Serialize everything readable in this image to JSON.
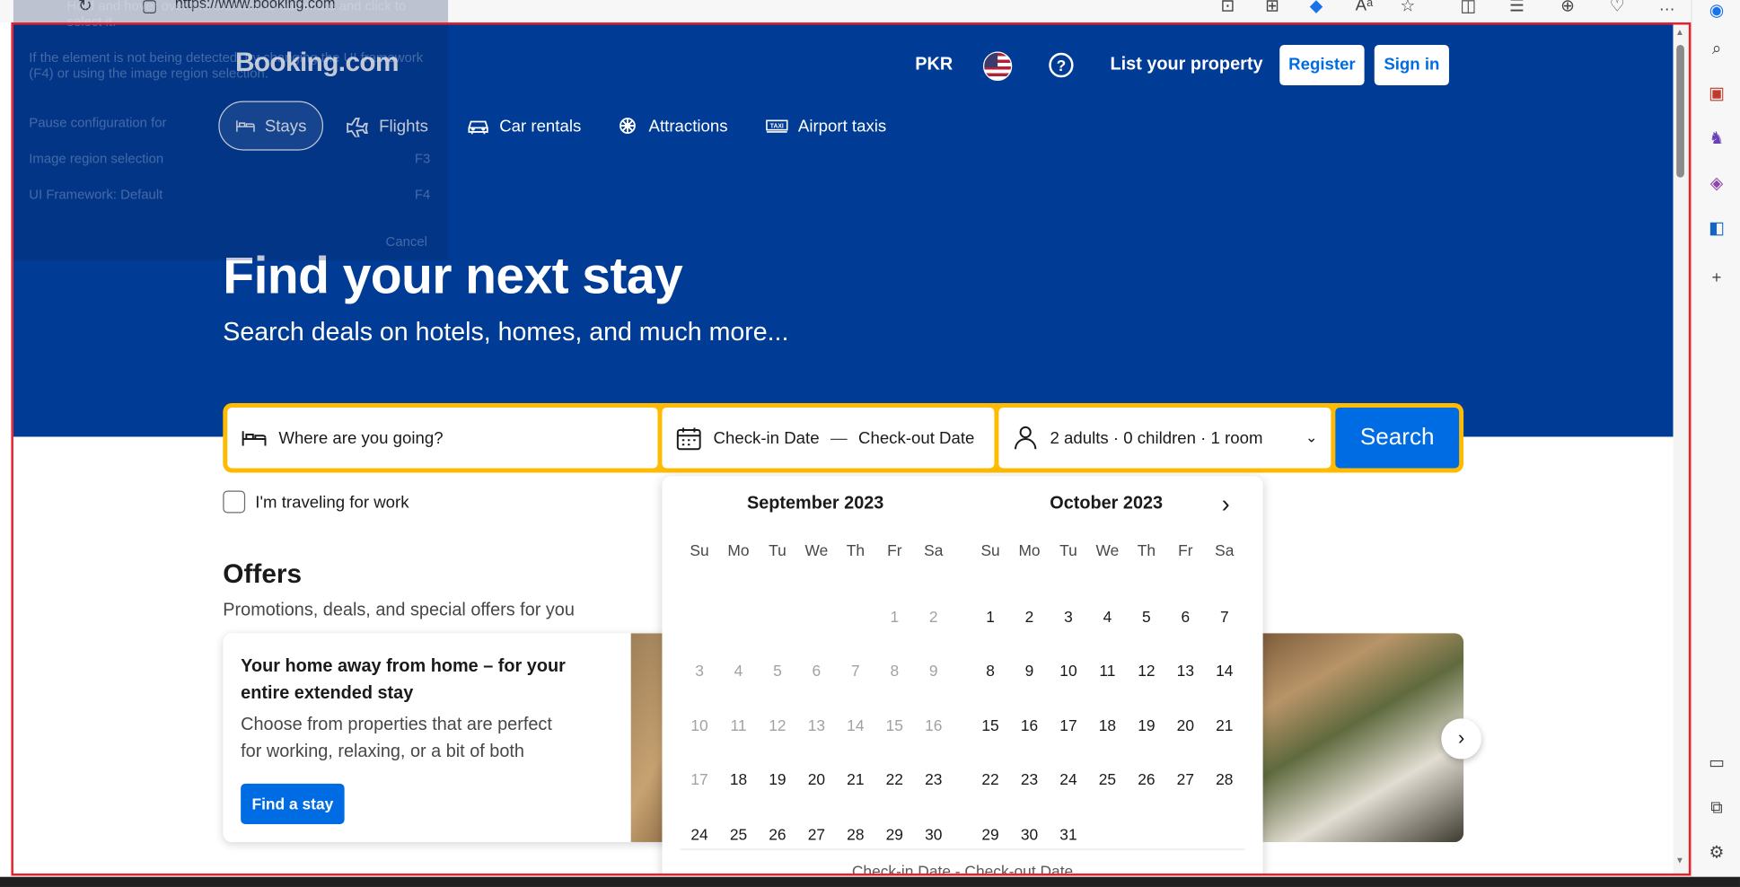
{
  "browser": {
    "url": "https://www.booking.com"
  },
  "overlay": {
    "line1": "Hold and hover over the element to automate and click to select it.",
    "line2": "If the element is not being detected, try changing the UI framework (F4) or using the image region selection.",
    "line3": "Pause configuration for",
    "line4": "Image region selection",
    "line4_key": "F3",
    "line5": "UI Framework: Default",
    "line5_key": "F4",
    "cancel": "Cancel"
  },
  "header": {
    "logo": "Booking.com",
    "currency": "PKR",
    "help_symbol": "?",
    "list_property": "List your property",
    "register": "Register",
    "sign_in": "Sign in"
  },
  "nav": {
    "items": [
      {
        "label": "Stays",
        "icon": "bed-icon",
        "active": true
      },
      {
        "label": "Flights",
        "icon": "plane-icon",
        "active": false
      },
      {
        "label": "Car rentals",
        "icon": "car-icon",
        "active": false
      },
      {
        "label": "Attractions",
        "icon": "attractions-icon",
        "active": false
      },
      {
        "label": "Airport taxis",
        "icon": "taxi-icon",
        "active": false
      }
    ]
  },
  "hero": {
    "title": "Find your next stay",
    "subtitle": "Search deals on hotels, homes, and much more..."
  },
  "search": {
    "destination_placeholder": "Where are you going?",
    "checkin": "Check-in Date",
    "date_separator": "—",
    "checkout": "Check-out Date",
    "occupancy": "2 adults · 0 children · 1 room",
    "button": "Search",
    "work_travel": "I'm traveling for work"
  },
  "calendar": {
    "weekdays": [
      "Su",
      "Mo",
      "Tu",
      "We",
      "Th",
      "Fr",
      "Sa"
    ],
    "months": [
      {
        "title": "September 2023",
        "first_weekday": 5,
        "days": 30,
        "past_until": 16,
        "past_extra": [
          17
        ]
      },
      {
        "title": "October 2023",
        "first_weekday": 0,
        "days": 31,
        "past_until": 0,
        "past_extra": []
      }
    ],
    "footer": "Check-in Date - Check-out Date"
  },
  "offers": {
    "title": "Offers",
    "subtitle": "Promotions, deals, and special offers for you",
    "card_title": "Your home away from home – for your entire extended stay",
    "card_desc": "Choose from properties that are perfect for working, relaxing, or a bit of both",
    "card_button": "Find a stay"
  },
  "colors": {
    "brand_blue": "#003b95",
    "action_blue": "#006ce4",
    "search_border": "#febb02"
  }
}
